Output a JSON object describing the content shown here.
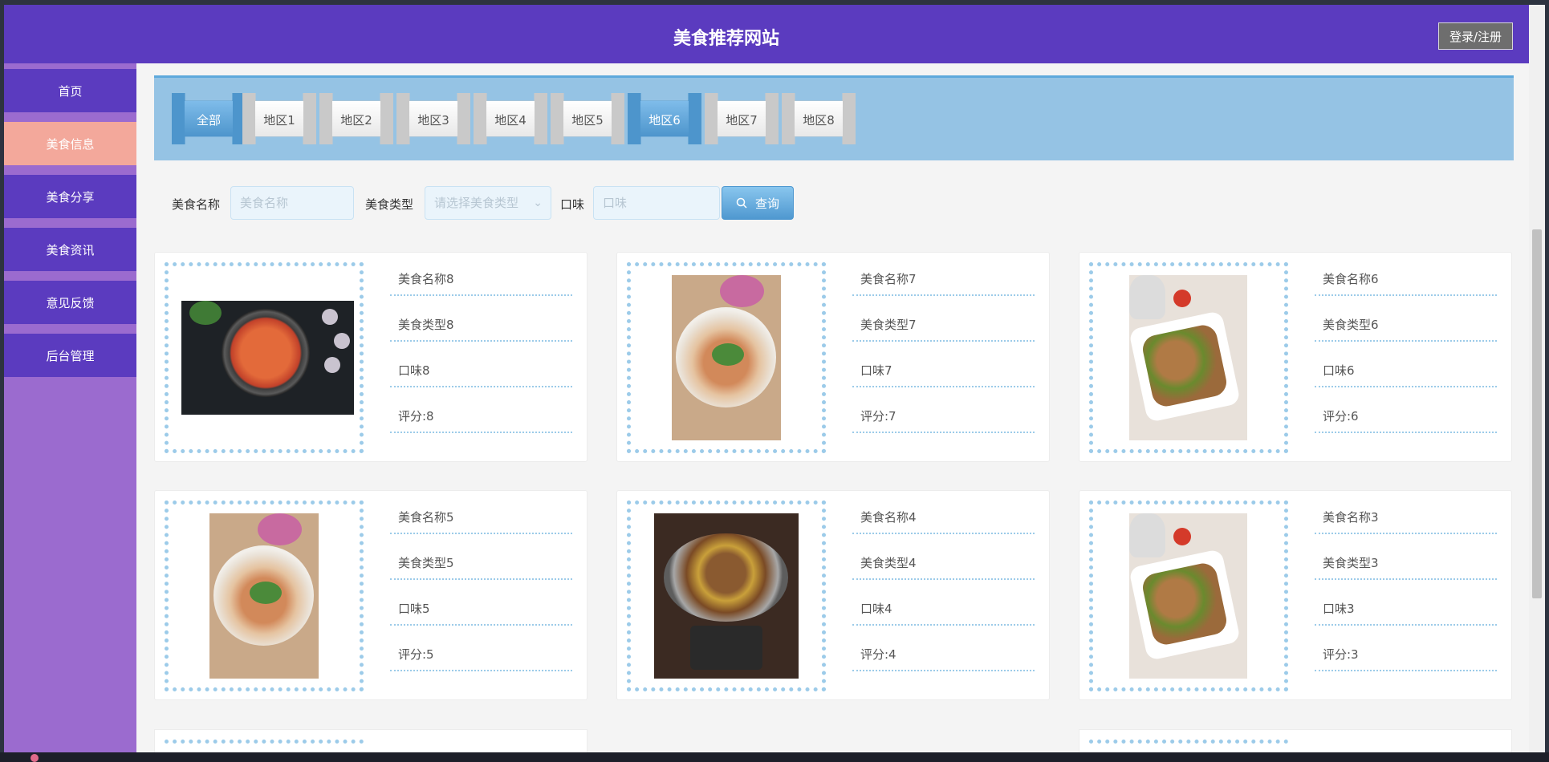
{
  "header": {
    "title": "美食推荐网站",
    "login_label": "登录/注册"
  },
  "sidebar": {
    "items": [
      {
        "label": "首页",
        "active": false
      },
      {
        "label": "美食信息",
        "active": true
      },
      {
        "label": "美食分享",
        "active": false
      },
      {
        "label": "美食资讯",
        "active": false
      },
      {
        "label": "意见反馈",
        "active": false
      },
      {
        "label": "后台管理",
        "active": false
      }
    ]
  },
  "regions": {
    "tabs": [
      {
        "label": "全部",
        "active": true
      },
      {
        "label": "地区1",
        "active": false
      },
      {
        "label": "地区2",
        "active": false
      },
      {
        "label": "地区3",
        "active": false
      },
      {
        "label": "地区4",
        "active": false
      },
      {
        "label": "地区5",
        "active": false
      },
      {
        "label": "地区6",
        "active": true
      },
      {
        "label": "地区7",
        "active": false
      },
      {
        "label": "地区8",
        "active": false
      }
    ]
  },
  "search": {
    "name_label": "美食名称",
    "name_placeholder": "美食名称",
    "type_label": "美食类型",
    "type_placeholder": "请选择美食类型",
    "taste_label": "口味",
    "taste_placeholder": "口味",
    "button_label": "查询"
  },
  "foods": [
    {
      "name": "美食名称8",
      "type": "美食类型8",
      "taste": "口味8",
      "score": "评分:8",
      "image": "hotpot"
    },
    {
      "name": "美食名称7",
      "type": "美食类型7",
      "taste": "口味7",
      "score": "评分:7",
      "image": "noodle"
    },
    {
      "name": "美食名称6",
      "type": "美食类型6",
      "taste": "口味6",
      "score": "评分:6",
      "image": "chicken"
    },
    {
      "name": "美食名称5",
      "type": "美食类型5",
      "taste": "口味5",
      "score": "评分:5",
      "image": "noodle"
    },
    {
      "name": "美食名称4",
      "type": "美食类型4",
      "taste": "口味4",
      "score": "评分:4",
      "image": "pot"
    },
    {
      "name": "美食名称3",
      "type": "美食类型3",
      "taste": "口味3",
      "score": "评分:3",
      "image": "chicken"
    }
  ],
  "colors": {
    "header_bg": "#5b3bbf",
    "sidebar_bg": "#9b6bcf",
    "active_menu": "#f3a89b",
    "banner_bg": "#95c3e4",
    "accent": "#4d95cc"
  }
}
